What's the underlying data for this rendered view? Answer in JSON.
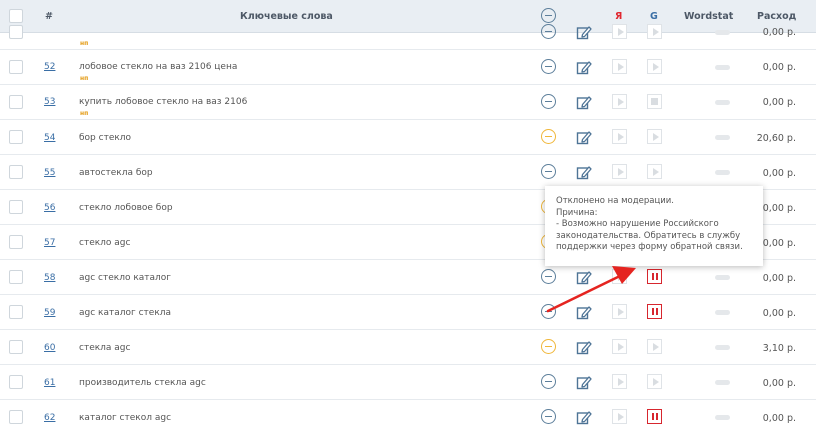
{
  "header": {
    "num": "#",
    "keywords": "Ключевые слова",
    "yandex": "Я",
    "google": "G",
    "wordstat": "Wordstat",
    "cost": "Расход"
  },
  "rows": [
    {
      "num": "",
      "keyword": "",
      "tag": "нп",
      "status": "neutral",
      "cost": "0,00 р.",
      "yandex": "play",
      "google": "play"
    },
    {
      "num": "52",
      "keyword": "лобовое стекло на ваз 2106 цена",
      "tag": "нп",
      "status": "neutral",
      "cost": "0,00 р.",
      "yandex": "play",
      "google": "play"
    },
    {
      "num": "53",
      "keyword": "купить лобовое стекло на ваз 2106",
      "tag": "нп",
      "status": "neutral",
      "cost": "0,00 р.",
      "yandex": "play",
      "google": "stop"
    },
    {
      "num": "54",
      "keyword": "бор стекло",
      "tag": "",
      "status": "warning",
      "cost": "20,60 р.",
      "yandex": "play",
      "google": "play"
    },
    {
      "num": "55",
      "keyword": "автостекла бор",
      "tag": "",
      "status": "neutral",
      "cost": "0,00 р.",
      "yandex": "play",
      "google": "play"
    },
    {
      "num": "56",
      "keyword": "стекло лобовое бор",
      "tag": "",
      "status": "warning",
      "cost": "0,00 р.",
      "yandex": "play",
      "google": "play"
    },
    {
      "num": "57",
      "keyword": "стекло agc",
      "tag": "",
      "status": "warning",
      "cost": "0,00 р.",
      "yandex": "play",
      "google": "play"
    },
    {
      "num": "58",
      "keyword": "agc стекло каталог",
      "tag": "",
      "status": "neutral",
      "cost": "0,00 р.",
      "yandex": "play",
      "google": "paused"
    },
    {
      "num": "59",
      "keyword": "agc каталог стекла",
      "tag": "",
      "status": "neutral",
      "cost": "0,00 р.",
      "yandex": "play",
      "google": "paused"
    },
    {
      "num": "60",
      "keyword": "стекла agc",
      "tag": "",
      "status": "warning",
      "cost": "3,10 р.",
      "yandex": "play",
      "google": "play"
    },
    {
      "num": "61",
      "keyword": "производитель стекла agc",
      "tag": "",
      "status": "neutral",
      "cost": "0,00 р.",
      "yandex": "play",
      "google": "play"
    },
    {
      "num": "62",
      "keyword": "каталог стекол agc",
      "tag": "",
      "status": "neutral",
      "cost": "0,00 р.",
      "yandex": "play",
      "google": "paused"
    }
  ],
  "tooltip": {
    "lines": [
      "Отклонено на модерации.",
      "Причина:",
      "- Возможно нарушение Российского",
      "законодательства. Обратитесь в службу",
      "поддержки через форму обратной связи."
    ]
  },
  "colors": {
    "accent_red": "#d7262e",
    "status_neutral": "#5d7f9b",
    "status_warning": "#f0b73a",
    "link": "#3a6ea5",
    "arrow": "#e52420"
  }
}
